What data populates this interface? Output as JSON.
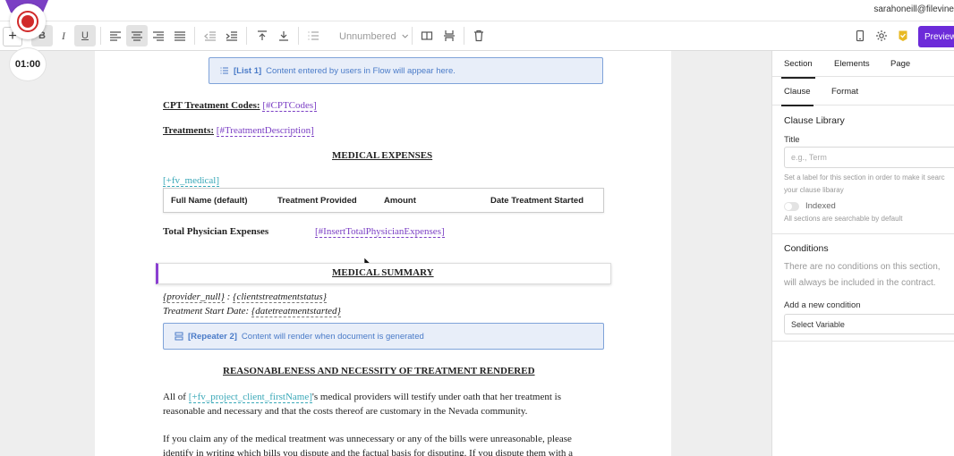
{
  "header": {
    "user_email": "sarahoneill@filevine"
  },
  "recorder": {
    "timer": "01:00"
  },
  "toolbar": {
    "list_style": "Unnumbered",
    "preview_label": "Preview",
    "active_buttons": [
      "underline",
      "align-center"
    ]
  },
  "document": {
    "list_box": {
      "tag": "[List 1]",
      "text": "Content entered by users in Flow will appear here."
    },
    "cpt_label": "CPT Treatment Codes:",
    "cpt_tag": "[#CPTCodes]",
    "treatments_label": "Treatments:",
    "treatments_tag": "[#TreatmentDescription]",
    "medical_expenses_heading": "MEDICAL EXPENSES",
    "fv_medical_tag": "[+fv_medical]",
    "expense_table_headers": [
      "Full Name (default)",
      "Treatment Provided",
      "Amount",
      "Date Treatment Started"
    ],
    "total_label": "Total Physician Expenses",
    "total_tag": "[#InsertTotalPhysicianExpenses]",
    "medical_summary_heading": "MEDICAL SUMMARY",
    "provider_null": "{provider_null}",
    "provider_sep": " : ",
    "clients_status": "{clientstreatmentstatus}",
    "start_date_label": "Treatment Start Date: ",
    "start_date_tag": "{datetreatmentstarted}",
    "repeater_box": {
      "tag": "[Repeater 2]",
      "text": "Content will render when document is generated"
    },
    "reasonableness_heading": "REASONABLENESS AND NECESSITY OF TREATMENT RENDERED",
    "para1_prefix": "All of ",
    "para1_tag": "[+fv_project_client_firstName]",
    "para1_suffix": "'s medical providers will testify under oath that her treatment is reasonable and necessary and that the costs thereof are customary in the Nevada community.",
    "para2": "If you claim any of the medical treatment was unnecessary or any of the bills were unreasonable, please identify in writing which bills you dispute and the factual basis for disputing. If you dispute them with a"
  },
  "panel": {
    "tabs": [
      "Section",
      "Elements",
      "Page"
    ],
    "subtabs": [
      "Clause",
      "Format"
    ],
    "clause_library_title": "Clause Library",
    "title_label": "Title",
    "title_placeholder": "e.g., Term",
    "title_help_1": "Set a label for this section in order to make it searc",
    "title_help_2": "your clause libaray",
    "indexed_label": "Indexed",
    "indexed_help": "All sections are searchable by default",
    "conditions_title": "Conditions",
    "conditions_empty_1": "There are no conditions on this section,",
    "conditions_empty_2": "will always be included in the contract.",
    "add_condition_label": "Add a new condition",
    "select_variable": "Select Variable"
  },
  "colors": {
    "accent": "#6c2bd9",
    "record": "#d12a2a",
    "merge_tag_purple": "#7b3fc4",
    "merge_tag_teal": "#3aa8b8",
    "info_box": "#e8eef9"
  },
  "icons": [
    "record-icon",
    "bold-icon",
    "italic-icon",
    "underline-icon",
    "align-left-icon",
    "align-center-icon",
    "align-right-icon",
    "justify-icon",
    "outdent-icon",
    "indent-icon",
    "move-up-icon",
    "move-down-icon",
    "list-icon",
    "chevron-down-icon",
    "column-icon",
    "page-break-icon",
    "trash-icon",
    "mobile-icon",
    "gear-icon",
    "badge-icon",
    "list-box-icon",
    "repeater-icon",
    "cursor-icon"
  ]
}
